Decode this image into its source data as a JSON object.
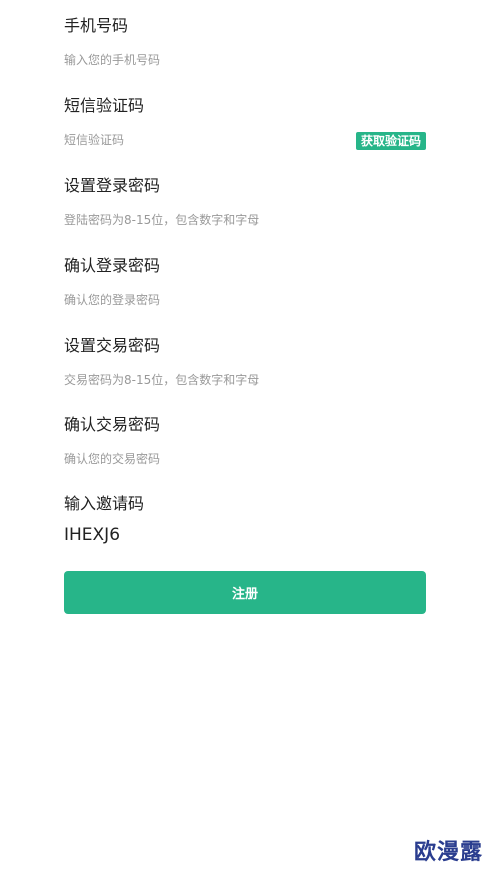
{
  "form": {
    "phone": {
      "label": "手机号码",
      "placeholder": "输入您的手机号码"
    },
    "sms": {
      "label": "短信验证码",
      "placeholder": "短信验证码",
      "get_code": "获取验证码"
    },
    "login_pwd": {
      "label": "设置登录密码",
      "placeholder": "登陆密码为8-15位，包含数字和字母"
    },
    "login_pwd_confirm": {
      "label": "确认登录密码",
      "placeholder": "确认您的登录密码"
    },
    "trade_pwd": {
      "label": "设置交易密码",
      "placeholder": "交易密码为8-15位，包含数字和字母"
    },
    "trade_pwd_confirm": {
      "label": "确认交易密码",
      "placeholder": "确认您的交易密码"
    },
    "invite": {
      "label": "输入邀请码",
      "value": "IHEXJ6"
    },
    "submit_label": "注册"
  },
  "watermark": "欧漫露",
  "colors": {
    "accent": "#27b589",
    "watermark": "#2a3d8f"
  }
}
